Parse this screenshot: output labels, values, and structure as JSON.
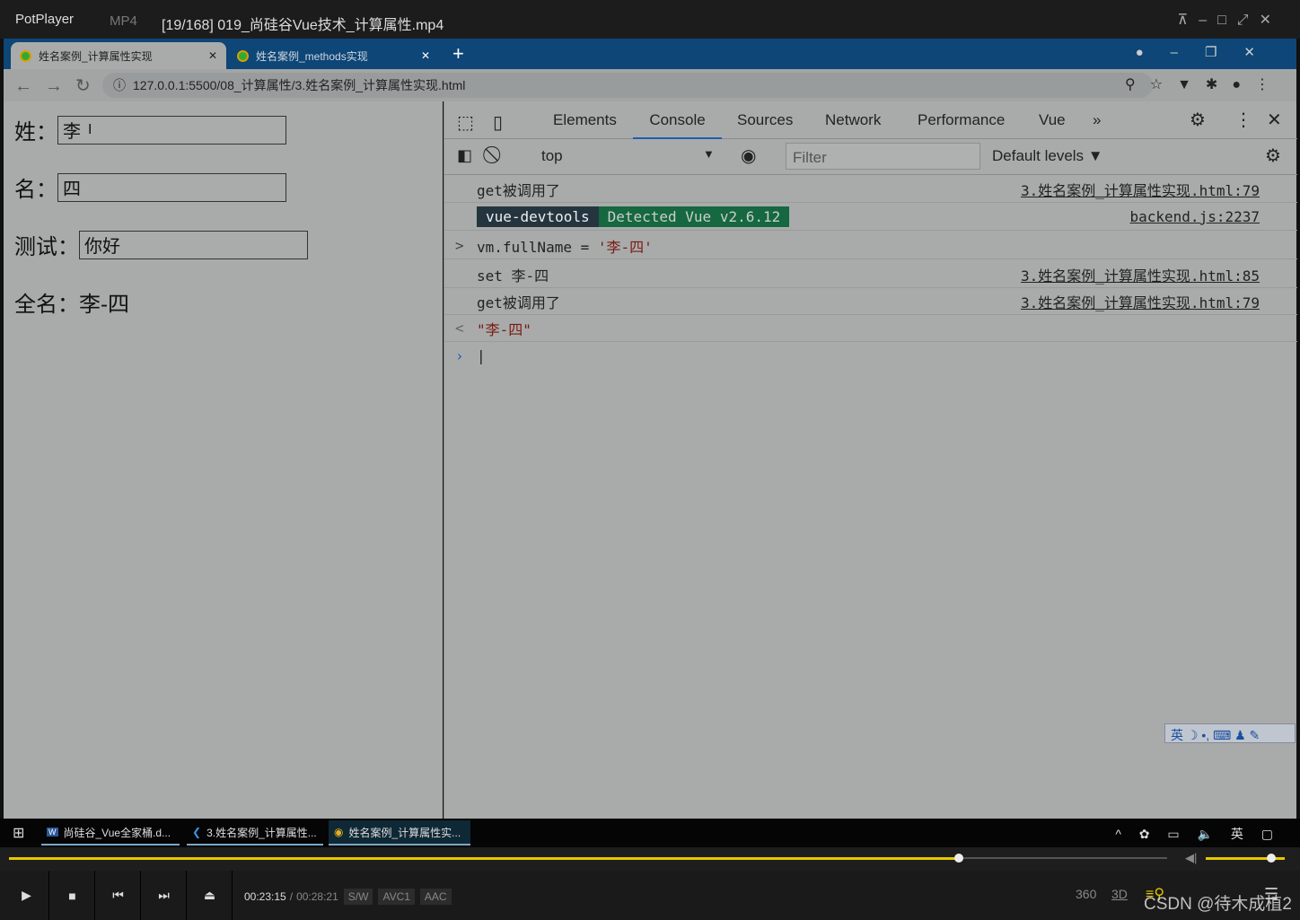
{
  "player": {
    "app": "PotPlayer",
    "format": "MP4",
    "file": "[19/168] 019_尚硅谷Vue技术_计算属性.mp4",
    "time_current": "00:23:15",
    "time_total": "00:28:21",
    "badges": [
      "S/W",
      "AVC1",
      "AAC"
    ],
    "progress": 0.82,
    "volume": 0.95,
    "icons": [
      "360",
      "3D"
    ],
    "watermark": "CSDN @待木成植2"
  },
  "browser": {
    "tabs": [
      {
        "label": "姓名案例_计算属性实现",
        "active": true
      },
      {
        "label": "姓名案例_methods实现",
        "active": false
      }
    ],
    "url": "127.0.0.1:5500/08_计算属性/3.姓名案例_计算属性实现.html"
  },
  "page": {
    "last_label": "姓：",
    "last_value": "李",
    "first_label": "名：",
    "first_value": "四",
    "test_label": "测试：",
    "test_value": "你好",
    "full_label": "全名：",
    "full_value": "李-四"
  },
  "devtools": {
    "tabs": [
      "Elements",
      "Console",
      "Sources",
      "Network",
      "Performance",
      "Vue"
    ],
    "active_tab": "Console",
    "context": "top",
    "filter_placeholder": "Filter",
    "levels": "Default levels ▼",
    "lines": [
      {
        "text": "get被调用了",
        "src": "3.姓名案例_计算属性实现.html:79"
      },
      {
        "badge1": "vue-devtools",
        "badge2": "Detected Vue v2.6.12",
        "src": "backend.js:2237"
      },
      {
        "prefix": ">",
        "text": "vm.fullName = ",
        "str": "'李-四'"
      },
      {
        "text": "set 李-四",
        "src": "3.姓名案例_计算属性实现.html:85"
      },
      {
        "text": "get被调用了",
        "src": "3.姓名案例_计算属性实现.html:79"
      },
      {
        "prefix": "<",
        "str": "\"李-四\""
      }
    ]
  },
  "taskbar": {
    "items": [
      "尚硅谷_Vue全家桶.d...",
      "3.姓名案例_计算属性...",
      "姓名案例_计算属性实..."
    ],
    "ime": "英"
  },
  "ime_bar": "英"
}
